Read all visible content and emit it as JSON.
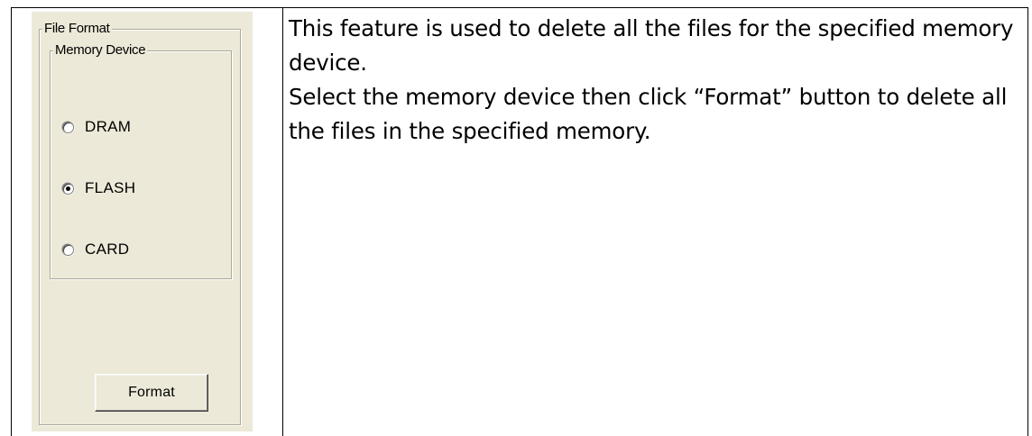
{
  "dialog": {
    "outer_group_title": "File Format",
    "inner_group_title": "Memory Device",
    "options": [
      {
        "label": "DRAM",
        "checked": false
      },
      {
        "label": "FLASH",
        "checked": true
      },
      {
        "label": "CARD",
        "checked": false
      }
    ],
    "format_button_label": "Format"
  },
  "description": {
    "paragraph_1": "This feature is used to delete all the files for the specified memory device.",
    "paragraph_2": "Select the memory device then click “Format” button to delete all the files in the specified memory."
  },
  "colors": {
    "dialog_background": "#ece9d8",
    "group_border": "#aca899",
    "text": "#000000"
  }
}
